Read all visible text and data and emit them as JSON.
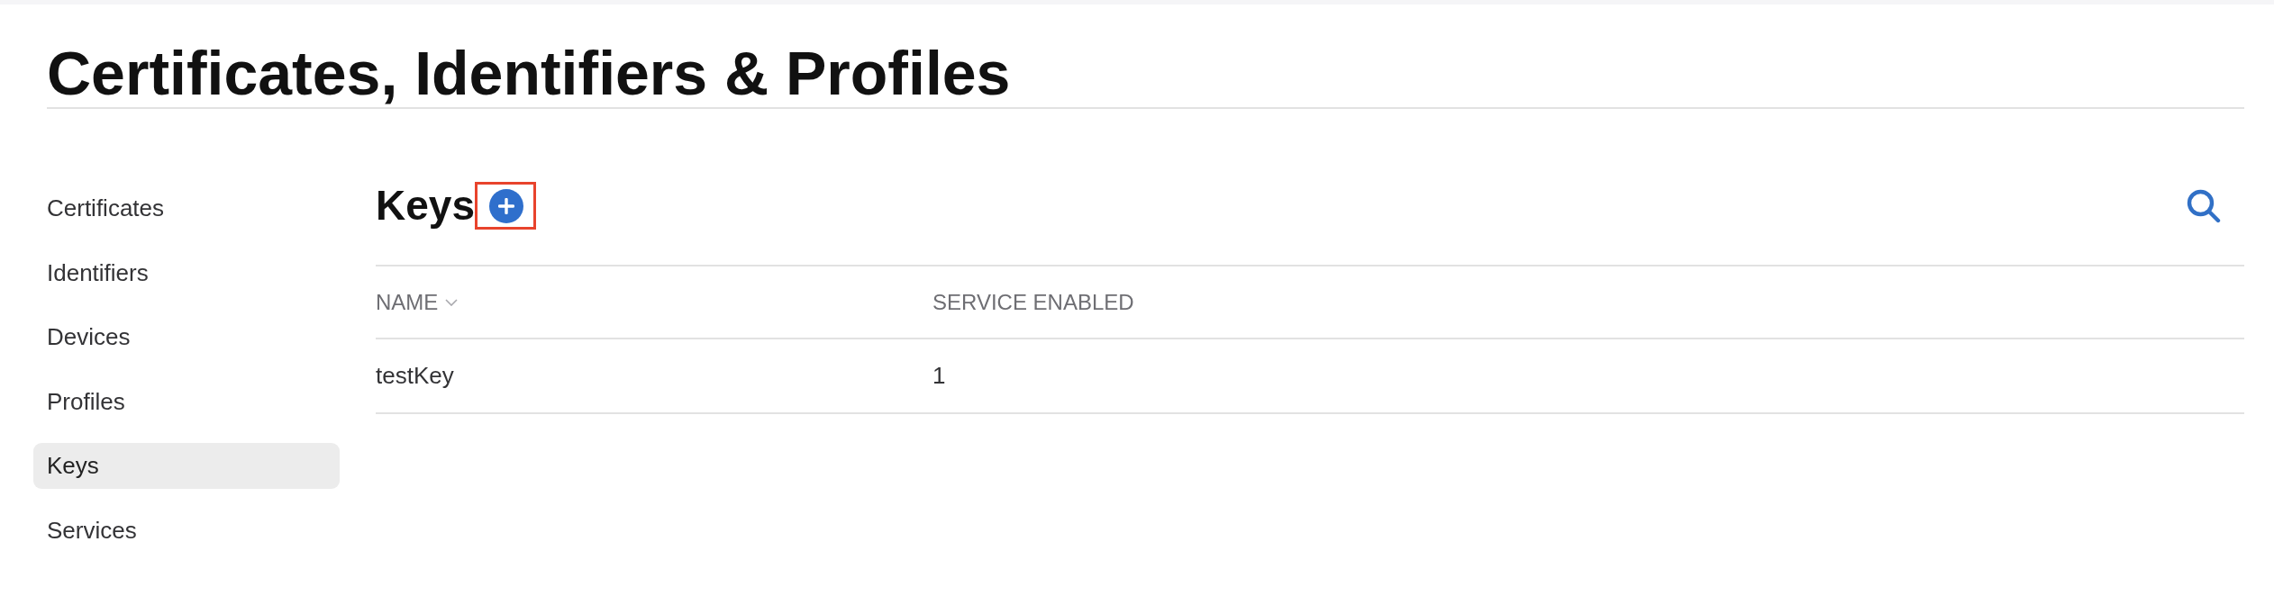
{
  "page": {
    "title": "Certificates, Identifiers & Profiles"
  },
  "sidebar": {
    "items": [
      {
        "label": "Certificates",
        "selected": false
      },
      {
        "label": "Identifiers",
        "selected": false
      },
      {
        "label": "Devices",
        "selected": false
      },
      {
        "label": "Profiles",
        "selected": false
      },
      {
        "label": "Keys",
        "selected": true
      },
      {
        "label": "Services",
        "selected": false
      }
    ]
  },
  "section": {
    "title": "Keys",
    "add_button": {
      "highlighted": true
    }
  },
  "table": {
    "columns": [
      {
        "label": "NAME",
        "sorted": true
      },
      {
        "label": "SERVICE ENABLED",
        "sorted": false
      }
    ],
    "rows": [
      {
        "cells": [
          "testKey",
          "1"
        ]
      }
    ]
  }
}
